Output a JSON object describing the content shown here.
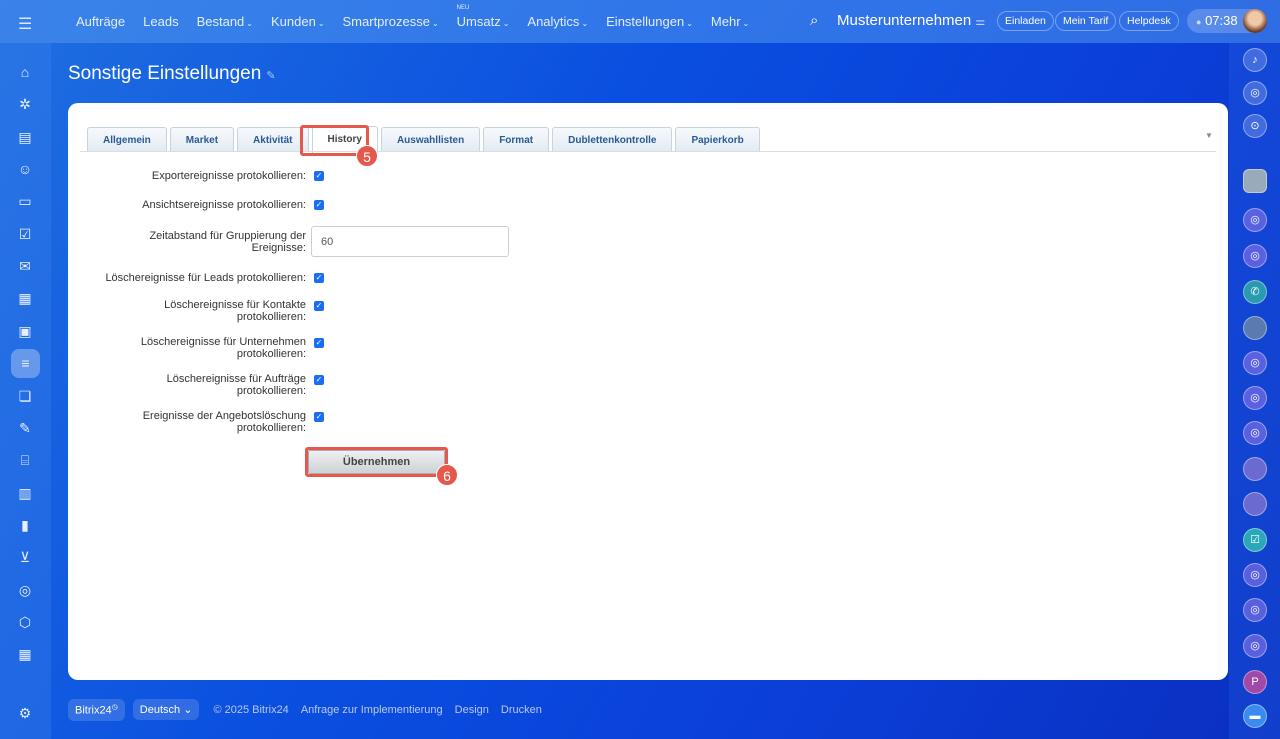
{
  "topnav": {
    "items": [
      {
        "label": "Aufträge"
      },
      {
        "label": "Leads"
      },
      {
        "label": "Bestand",
        "dropdown": true
      },
      {
        "label": "Kunden",
        "dropdown": true
      },
      {
        "label": "Smartprozesse",
        "dropdown": true
      },
      {
        "label": "Umsatz",
        "dropdown": true,
        "badge": "NEU"
      },
      {
        "label": "Analytics",
        "dropdown": true
      },
      {
        "label": "Einstellungen",
        "dropdown": true
      },
      {
        "label": "Mehr",
        "dropdown": true
      }
    ],
    "company": "Musterunternehmen",
    "invite": "Einladen",
    "plan": "Mein Tarif",
    "helpdesk": "Helpdesk",
    "time": "07:38"
  },
  "page": {
    "title": "Sonstige Einstellungen"
  },
  "tabs": [
    "Allgemein",
    "Market",
    "Aktivität",
    "History",
    "Auswahllisten",
    "Format",
    "Dublettenkontrolle",
    "Papierkorb"
  ],
  "active_tab": "History",
  "form": {
    "export": {
      "label": "Exportereignisse protokollieren:",
      "checked": true
    },
    "view": {
      "label": "Ansichtsereignisse protokollieren:",
      "checked": true
    },
    "interval": {
      "label": "Zeitabstand für Gruppierung der Ereignisse:",
      "value": "60"
    },
    "del_leads": {
      "label": "Löschereignisse für Leads protokollieren:",
      "checked": true
    },
    "del_contacts": {
      "label": "Löschereignisse für Kontakte protokollieren:",
      "checked": true
    },
    "del_companies": {
      "label": "Löschereignisse für Unternehmen protokollieren:",
      "checked": true
    },
    "del_orders": {
      "label": "Löschereignisse für Aufträge protokollieren:",
      "checked": true
    },
    "del_quotes": {
      "label": "Ereignisse der Angebotslöschung protokollieren:",
      "checked": true
    },
    "apply": "Übernehmen"
  },
  "annotations": {
    "step5": "5",
    "step6": "6"
  },
  "footer": {
    "brand": "Bitrix24",
    "language": "Deutsch",
    "copyright": "© 2025 Bitrix24",
    "links": [
      "Anfrage zur Implementierung",
      "Design",
      "Drucken"
    ]
  },
  "colors": {
    "accent": "#1b6ef3",
    "highlight": "#e5584c"
  }
}
